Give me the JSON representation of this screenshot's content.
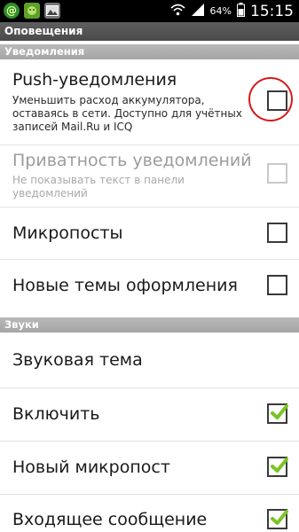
{
  "statusbar": {
    "icons": [
      "mail-ru-agent-icon",
      "android-icon",
      "image-icon"
    ],
    "battery": "64%",
    "time": "15:15"
  },
  "header": {
    "title": "Оповещения"
  },
  "sections": {
    "notifications": "Уведомления",
    "sounds": "Звуки"
  },
  "rows": {
    "push": {
      "title": "Push-уведомления",
      "subtitle": "Уменьшить расход аккумулятора, оставаясь в сети. Доступно для учётных записей Mail.Ru и ICQ",
      "checked": false
    },
    "privacy": {
      "title": "Приватность уведомлений",
      "subtitle": "Не показывать текст в панели уведомлений",
      "checked": false,
      "enabled": false
    },
    "microposts": {
      "title": "Микропосты",
      "checked": false
    },
    "themes": {
      "title": "Новые темы оформления",
      "checked": false
    },
    "sound_theme": {
      "title": "Звуковая тема"
    },
    "enable": {
      "title": "Включить",
      "checked": true
    },
    "new_micropost": {
      "title": "Новый микропост",
      "checked": true
    },
    "incoming": {
      "title": "Входящее сообщение",
      "checked": true
    }
  },
  "colors": {
    "check": "#7bc425",
    "highlight": "#d81818"
  }
}
